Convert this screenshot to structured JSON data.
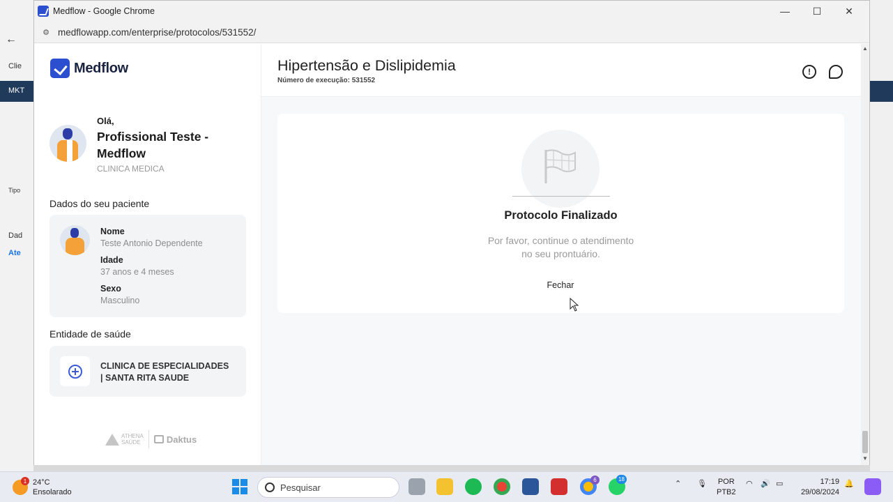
{
  "browser": {
    "window_title": "Medflow - Google Chrome",
    "url": "medflowapp.com/enterprise/protocolos/531552/",
    "controls": {
      "minimize": "—",
      "maximize": "☐",
      "close": "✕"
    }
  },
  "background_window": {
    "labels": [
      "Clie",
      "MKT",
      "Tipo",
      "Dad",
      "Ate"
    ]
  },
  "app": {
    "logo_text": "Medflow",
    "accent_color": "#2b4fce"
  },
  "profile": {
    "greeting": "Olá,",
    "name": "Profissional Teste - Medflow",
    "specialty": "CLINICA MEDICA"
  },
  "patient": {
    "section_title": "Dados do seu paciente",
    "fields": [
      {
        "label": "Nome",
        "value": "Teste Antonio Dependente"
      },
      {
        "label": "Idade",
        "value": "37 anos e 4 meses"
      },
      {
        "label": "Sexo",
        "value": "Masculino"
      }
    ]
  },
  "entity": {
    "section_title": "Entidade de saúde",
    "name": "CLINICA DE ESPECIALIDADES | SANTA RITA SAUDE"
  },
  "footer": {
    "athena": "ATHENA",
    "athena_sub": "SAÚDE",
    "daktus": "Daktus"
  },
  "header": {
    "title": "Hipertensão e Dislipidemia",
    "exec_label": "Número de execução: 531552",
    "info_icon": "info-icon",
    "chat_icon": "chat-icon"
  },
  "result": {
    "icon": "flag-icon",
    "title": "Protocolo Finalizado",
    "message_line1": "Por favor, continue o atendimento",
    "message_line2": "no seu prontuário.",
    "button": "Fechar"
  },
  "taskbar": {
    "weather_temp": "24°C",
    "weather_desc": "Ensolarado",
    "weather_badge": "1",
    "search_placeholder": "Pesquisar",
    "lang_line1": "POR",
    "lang_line2": "PTB2",
    "time": "17:19",
    "date": "29/08/2024",
    "chrome_badge": "6",
    "whatsapp_badge": "18"
  }
}
